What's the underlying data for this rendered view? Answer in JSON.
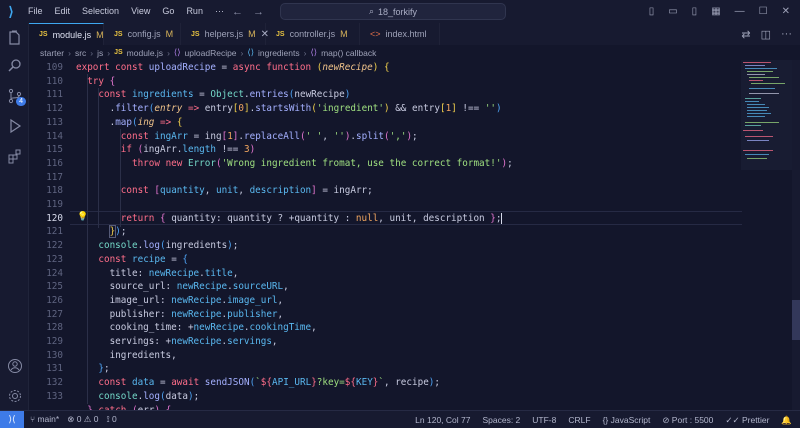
{
  "titlebar": {
    "menu": [
      "File",
      "Edit",
      "Selection",
      "View",
      "Go",
      "Run",
      "···"
    ],
    "search": "18_forkify",
    "back_glyph": "←",
    "forward_glyph": "→",
    "search_glyph": "⌕"
  },
  "activity_bar": {
    "items": [
      "explorer-icon",
      "search-icon",
      "source-control-icon",
      "run-debug-icon",
      "extensions-icon"
    ],
    "source_control_badge": "4",
    "bottom": [
      "account-icon",
      "settings-gear-icon"
    ]
  },
  "tabs": [
    {
      "badge": "JS",
      "label": "module.js",
      "status": "M",
      "active": true
    },
    {
      "badge": "JS",
      "label": "config.js",
      "status": "M",
      "active": false
    },
    {
      "badge": "JS",
      "label": "helpers.js",
      "status": "M",
      "active": false
    },
    {
      "badge": "JS",
      "label": "controller.js",
      "status": "M",
      "active": false
    },
    {
      "badge": "<>",
      "label": "index.html",
      "status": "",
      "active": false
    }
  ],
  "breadcrumb": [
    "starter",
    "src",
    "js",
    "module.js",
    "uploadRecipe",
    "ingredients",
    "map() callback"
  ],
  "editor": {
    "current_line": 120,
    "line_numbers": [
      109,
      110,
      111,
      112,
      113,
      114,
      115,
      116,
      117,
      118,
      119,
      120,
      121,
      122,
      123,
      124,
      125,
      126,
      127,
      128,
      129,
      130,
      131,
      132,
      133
    ]
  },
  "statusbar": {
    "branch": "main*",
    "errors": "0",
    "warnings": "0",
    "ports": "0",
    "position": "Ln 120, Col 77",
    "spaces": "Spaces: 2",
    "encoding": "UTF-8",
    "eol": "CRLF",
    "language": "JavaScript",
    "port": "Port : 5500",
    "prettier": "Prettier"
  },
  "colors": {
    "accent": "#3e7be8",
    "background": "#13162b",
    "keyword": "#ff6e8a",
    "function": "#a4b0ff",
    "string": "#9fe080"
  }
}
